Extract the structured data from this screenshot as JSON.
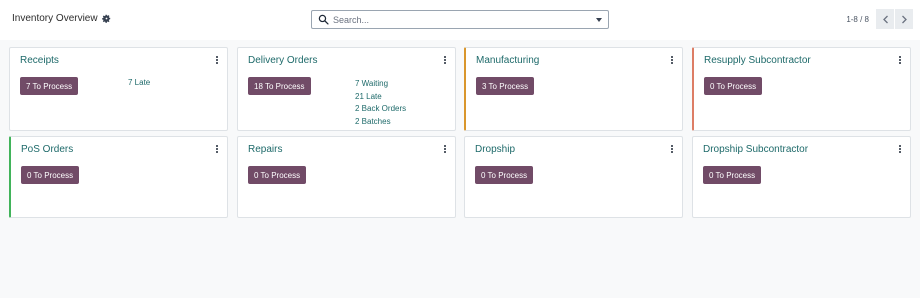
{
  "header": {
    "breadcrumb_title": "Inventory Overview",
    "settings_icon": "gear-icon"
  },
  "search": {
    "icon": "search-icon",
    "placeholder": "Search...",
    "value": ""
  },
  "pager": {
    "value": "1-8 / 8",
    "prev_icon": "chevron-left-icon",
    "next_icon": "chevron-right-icon"
  },
  "colors": {
    "process_button": "#714b67",
    "title_link": "#1e6a6a",
    "accent_manufacturing": "#d9962c",
    "accent_resupply": "#dd7d65",
    "accent_pos": "#41b35a"
  },
  "cards": [
    {
      "title": "Receipts",
      "button": "7 To Process",
      "stats": [
        "7 Late"
      ]
    },
    {
      "title": "Delivery Orders",
      "button": "18 To Process",
      "stats": [
        "7 Waiting",
        "21 Late",
        "2 Back Orders",
        "2 Batches"
      ]
    },
    {
      "title": "Manufacturing",
      "button": "3 To Process",
      "stats": []
    },
    {
      "title": "Resupply Subcontractor",
      "button": "0 To Process",
      "stats": []
    },
    {
      "title": "PoS Orders",
      "button": "0 To Process",
      "stats": []
    },
    {
      "title": "Repairs",
      "button": "0 To Process",
      "stats": []
    },
    {
      "title": "Dropship",
      "button": "0 To Process",
      "stats": []
    },
    {
      "title": "Dropship Subcontractor",
      "button": "0 To Process",
      "stats": []
    }
  ]
}
